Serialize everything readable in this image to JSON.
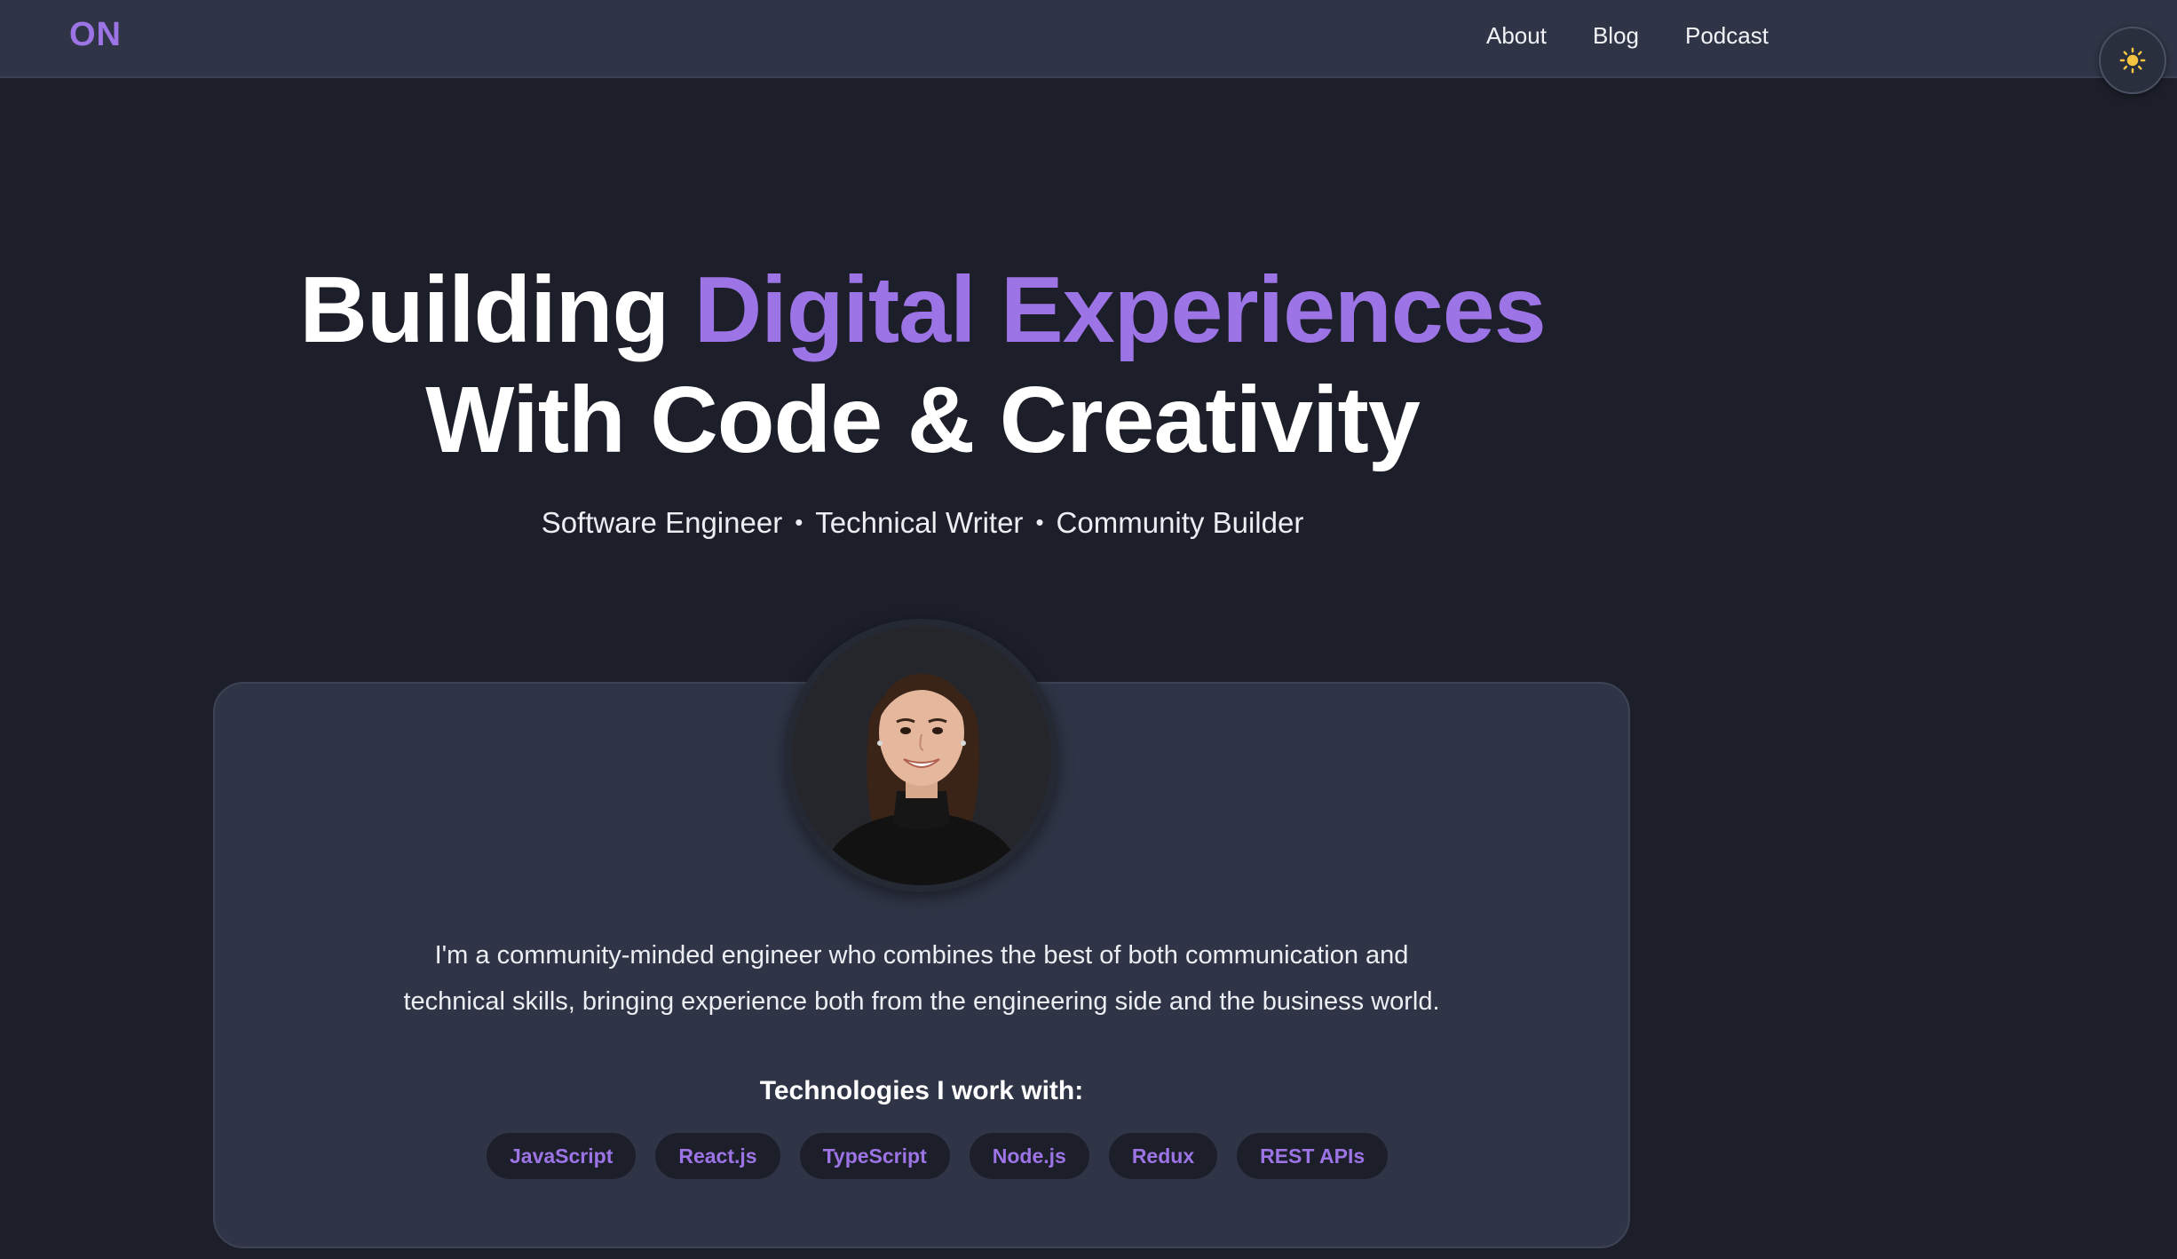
{
  "colors": {
    "background": "#1c1f2a",
    "surface": "#2f3546",
    "accent": "#9d74e6",
    "text": "#ffffff"
  },
  "header": {
    "logo": "ON",
    "nav": [
      {
        "label": "About"
      },
      {
        "label": "Blog"
      },
      {
        "label": "Podcast"
      }
    ],
    "theme_toggle_icon": "sun-icon"
  },
  "hero": {
    "title_start": "Building ",
    "title_accent": "Digital Experiences",
    "title_end": "With Code & Creativity",
    "roles": [
      "Software Engineer",
      "Technical Writer",
      "Community Builder"
    ],
    "separator": "•"
  },
  "profile": {
    "avatar_icon": "profile-photo",
    "bio_line1": "I'm a community-minded engineer who combines the best of both communication and",
    "bio_line2": "technical skills, bringing experience both from the engineering side and the business world.",
    "tech_heading": "Technologies I work with:",
    "technologies": [
      "JavaScript",
      "React.js",
      "TypeScript",
      "Node.js",
      "Redux",
      "REST APIs"
    ]
  }
}
